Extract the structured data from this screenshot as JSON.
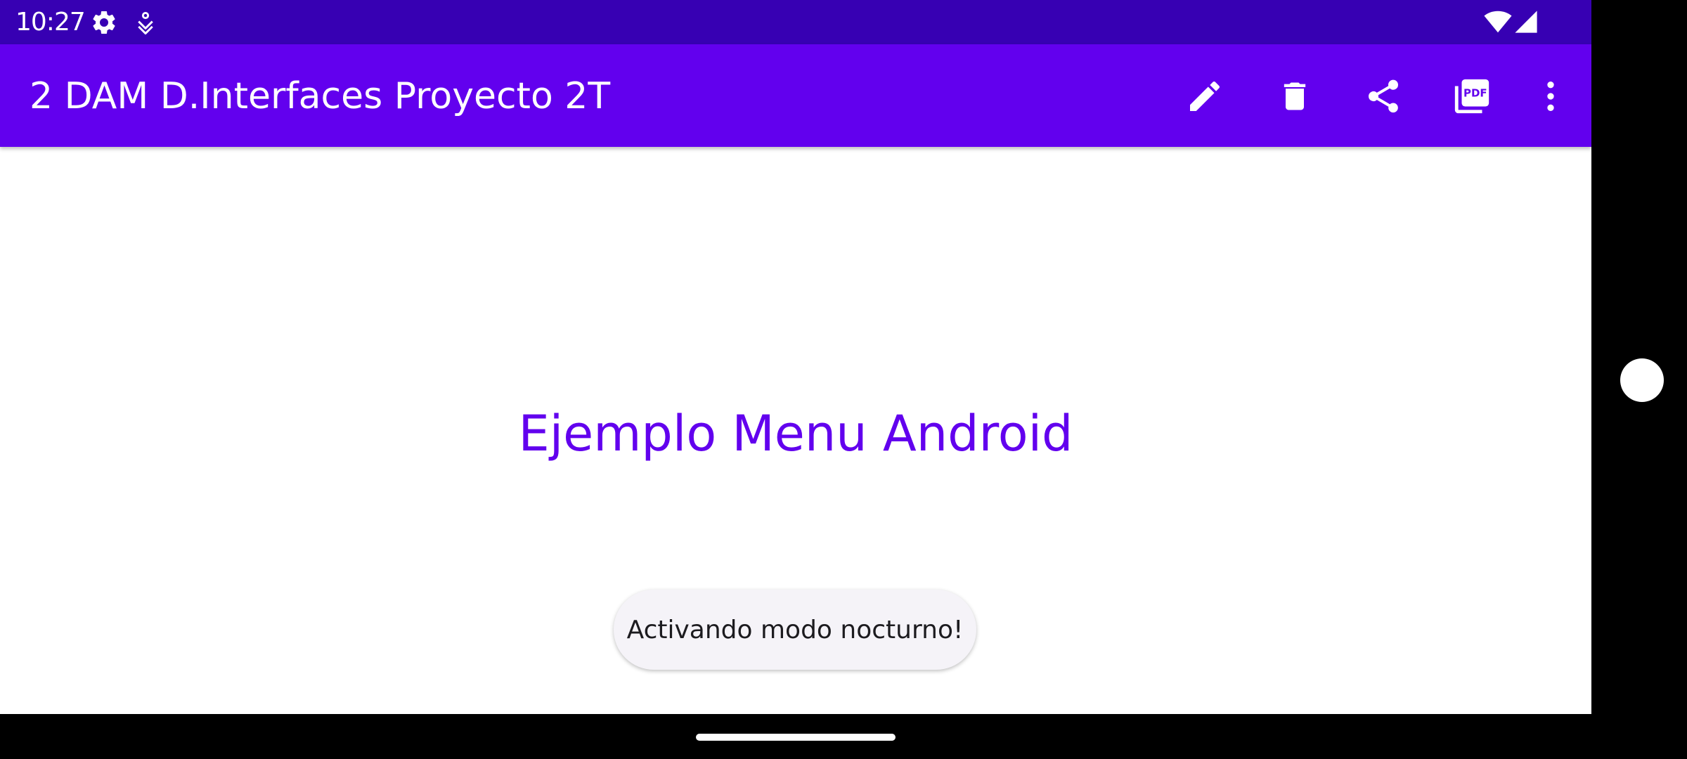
{
  "status_bar": {
    "time": "10:27",
    "left_icons": [
      "settings-gear-icon",
      "accessibility-icon"
    ],
    "right_icons": [
      "wifi-icon",
      "signal-icon"
    ]
  },
  "app_bar": {
    "title": "2 DAM D.Interfaces Proyecto 2T",
    "actions": [
      "edit-icon",
      "delete-icon",
      "share-icon",
      "pdf-icon",
      "more-vert-icon"
    ],
    "pdf_badge": "PDF"
  },
  "main": {
    "text": "Ejemplo Menu Android"
  },
  "toast": {
    "message": "Activando modo nocturno!"
  },
  "colors": {
    "status_bar": "#3700b3",
    "primary": "#6200ee",
    "background": "#ffffff",
    "toast_bg": "#f5f3f8"
  }
}
